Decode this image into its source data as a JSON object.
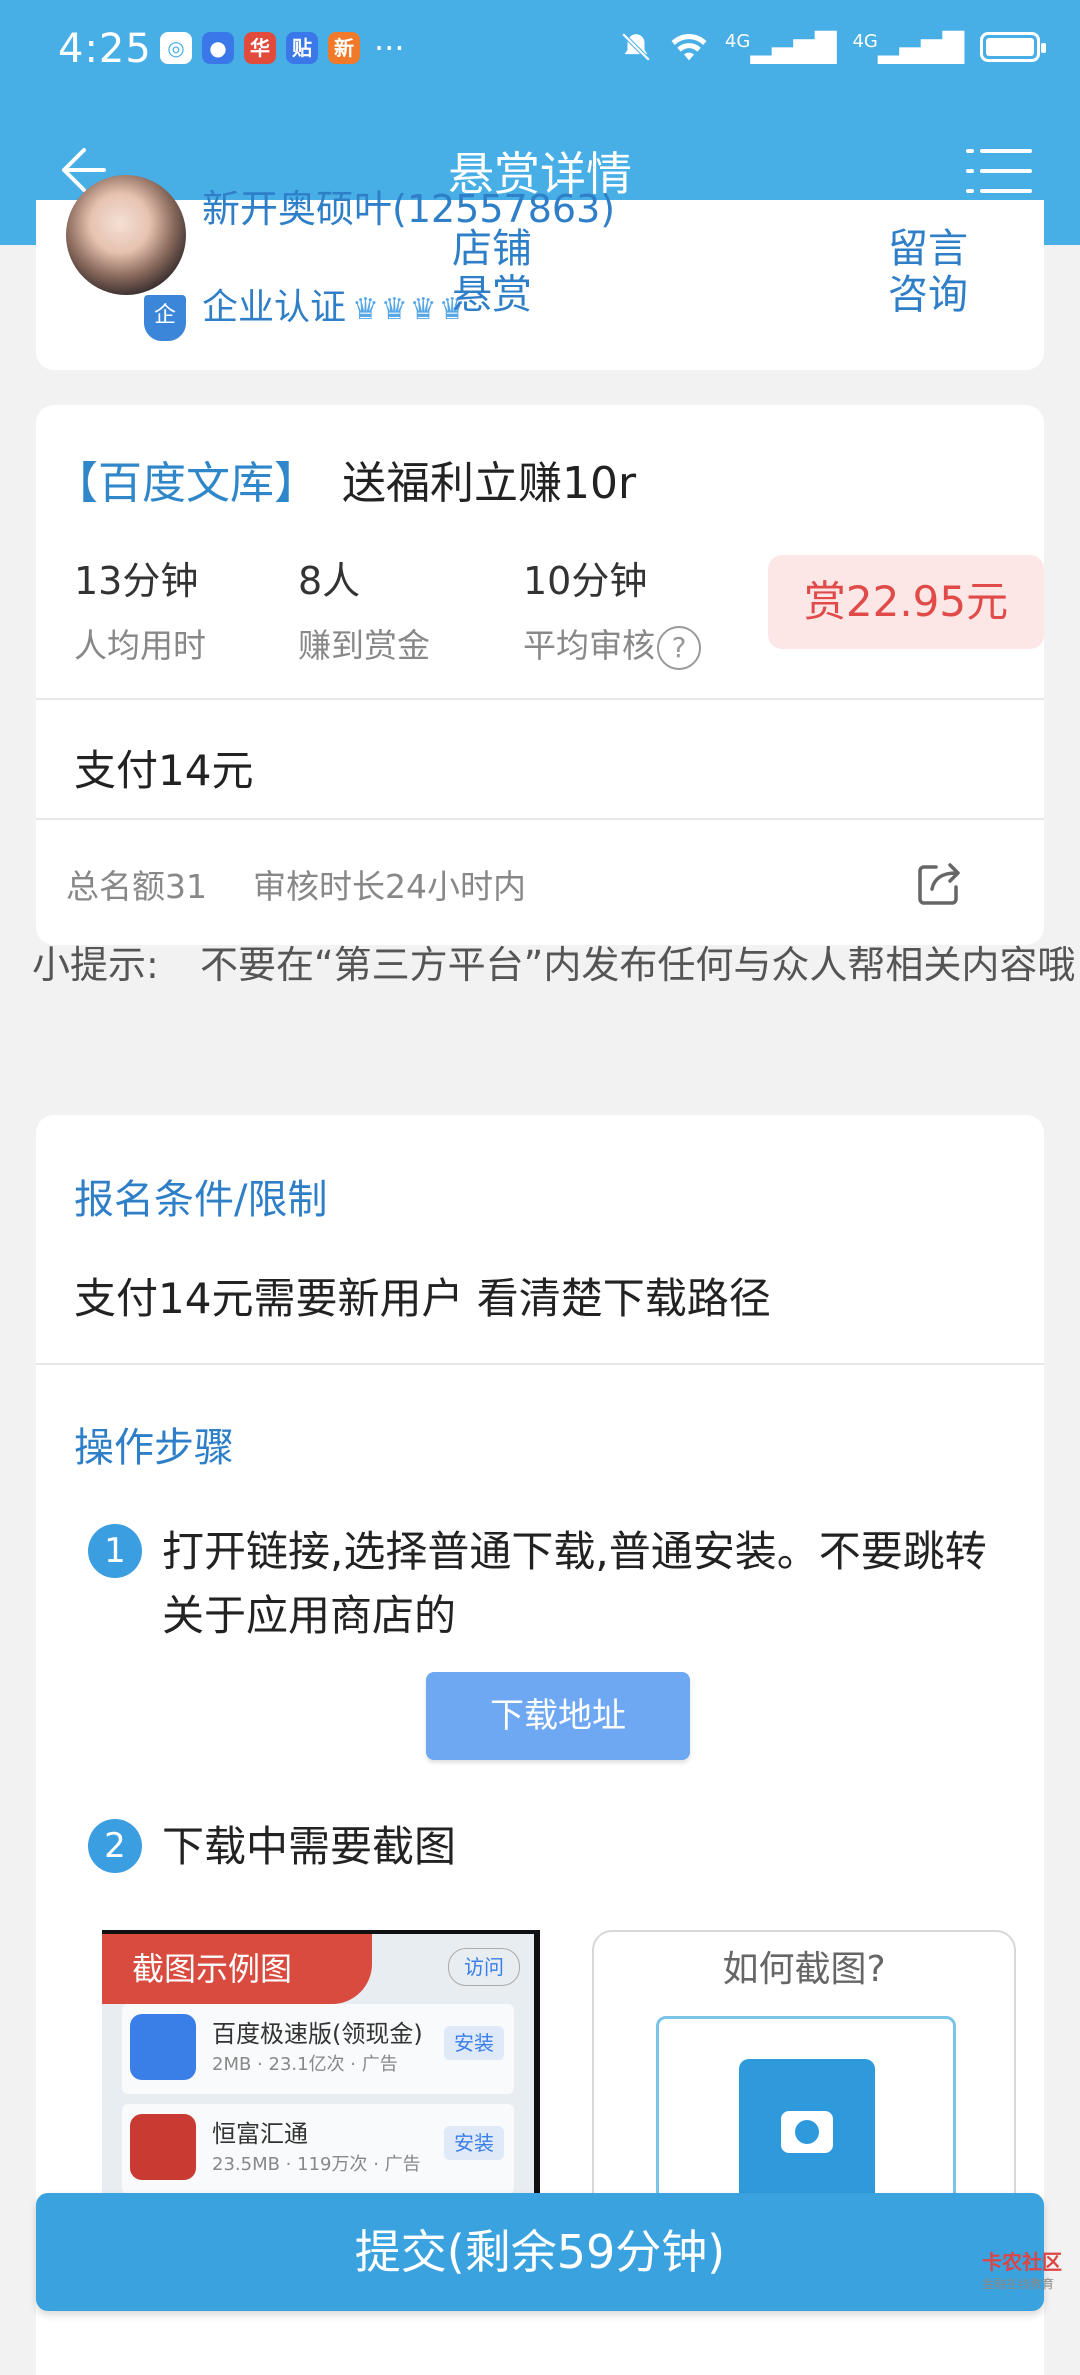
{
  "status": {
    "time": "4:25",
    "apps": [
      "◎",
      "●",
      "华",
      "贴",
      "新"
    ],
    "more": "···",
    "signal1": "4G",
    "signal2": "4G"
  },
  "header": {
    "title": "悬赏详情"
  },
  "store": {
    "name": "新开奥硕叶(12557863)",
    "cert": "企业认证",
    "crowns": "♛♛♛♛",
    "badge": "企",
    "shop_btn_line1": "店铺",
    "shop_btn_line2": "悬赏",
    "msg_btn_line1": "留言",
    "msg_btn_line2": "咨询"
  },
  "task": {
    "tag": "【百度文库】",
    "title": "送福利立赚10r",
    "stats": [
      {
        "value": "13分钟",
        "label": "人均用时"
      },
      {
        "value": "8人",
        "label": "赚到赏金"
      },
      {
        "value": "10分钟",
        "label": "平均审核"
      }
    ],
    "help": "?",
    "reward": "赏22.95元",
    "pay": "支付14元",
    "quota": "总名额31",
    "review": "审核时长24小时内"
  },
  "tip": {
    "label": "小提示:",
    "text": "不要在“第三方平台”内发布任何与众人帮相关内容哦!"
  },
  "conditions": {
    "title": "报名条件/限制",
    "text": "支付14元需要新用户 看清楚下载路径"
  },
  "steps": {
    "title": "操作步骤",
    "items": [
      {
        "num": "1",
        "text": "打开链接,选择普通下载,普通安装。不要跳转关于应用商店的"
      },
      {
        "num": "2",
        "text": "下载中需要截图"
      }
    ],
    "download_btn": "下载地址",
    "example_label": "截图示例图",
    "example_rows": [
      {
        "title": "百度极速版(领现金)",
        "sub": "2MB · 23.1亿次 · 广告",
        "btn": "安装"
      },
      {
        "title": "恒富汇通",
        "sub": "23.5MB · 119万次 · 广告",
        "btn": "安装"
      }
    ],
    "example_visit": "访问",
    "howto": "如何截图?"
  },
  "submit": {
    "label": "提交(剩余59分钟)"
  },
  "watermark": {
    "brand": "卡农社区",
    "sub": "金融在线教育"
  }
}
